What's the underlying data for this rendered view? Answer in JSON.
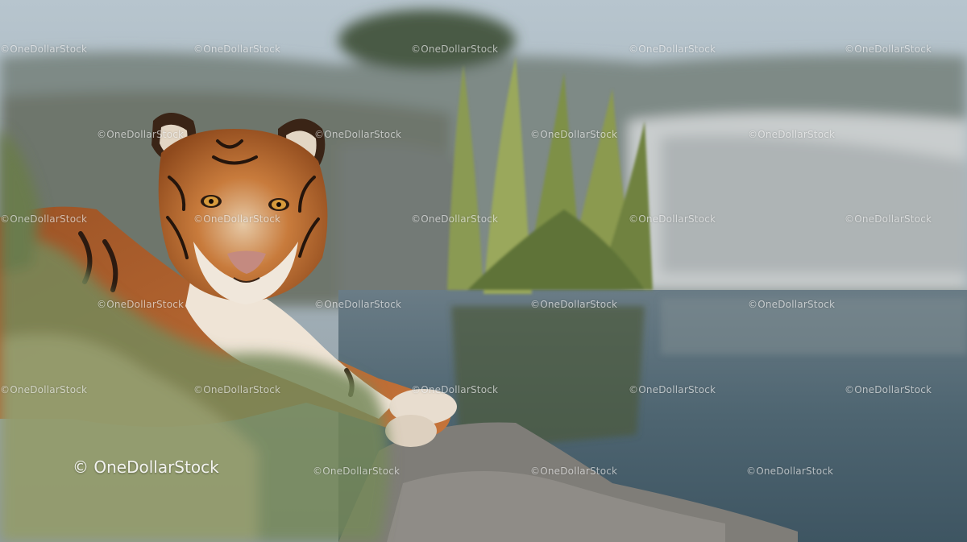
{
  "image": {
    "subject": "tiger",
    "colors": {
      "sky": "#a9b8c2",
      "water": "#4f6470",
      "fur": "#b8652a",
      "grass": "#7b8f55",
      "rock": "#8e8b86"
    }
  },
  "watermark": {
    "text": "©OneDollarStock",
    "brand_text": "© OneDollarStock"
  }
}
